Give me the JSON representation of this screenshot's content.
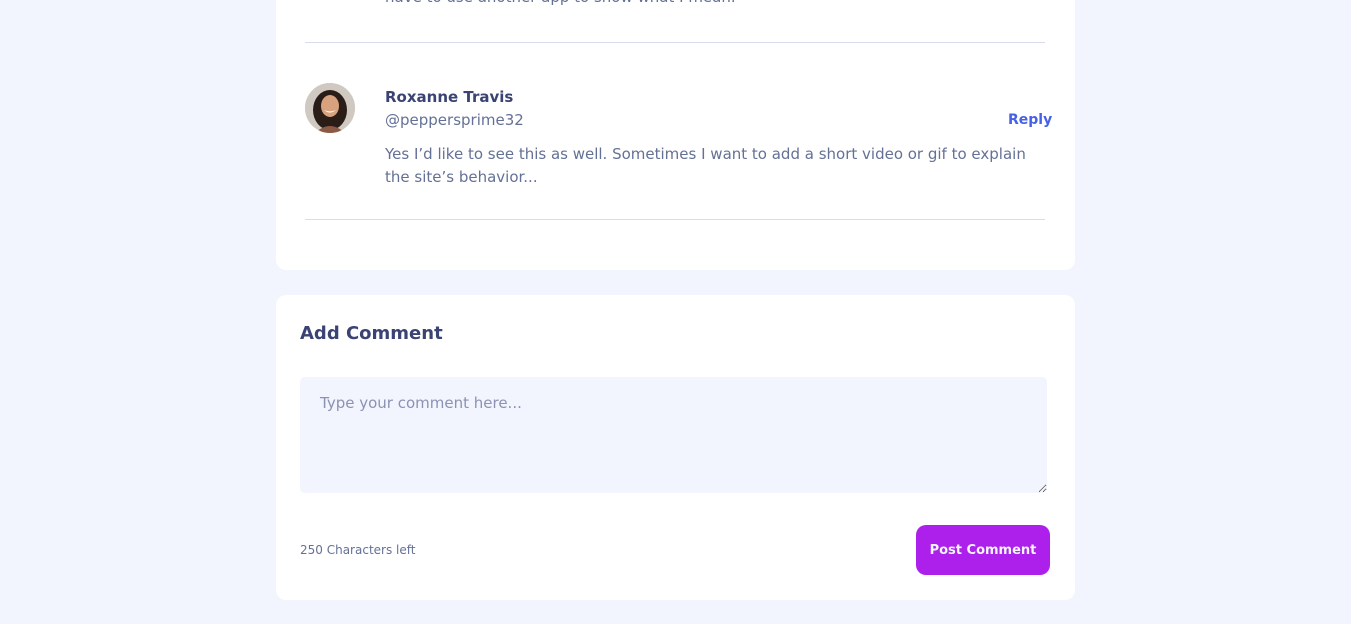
{
  "comments": {
    "previous_comment_tail": "have to use another app to show what I mean.",
    "items": [
      {
        "name": "Roxanne Travis",
        "handle": "@peppersprime32",
        "reply_label": "Reply",
        "body": "Yes I’d like to see this as well. Sometimes I want to add a short video or gif to explain the site’s behavior..."
      }
    ]
  },
  "add_comment": {
    "title": "Add Comment",
    "placeholder": "Type your comment here...",
    "value": "",
    "chars_left": "250 Characters left",
    "post_label": "Post Comment"
  },
  "colors": {
    "page_bg": "#f2f4fe",
    "card_bg": "#ffffff",
    "title": "#3a4374",
    "body_text": "#647196",
    "link_blue": "#4661e6",
    "button_purple": "#ad1fea"
  }
}
